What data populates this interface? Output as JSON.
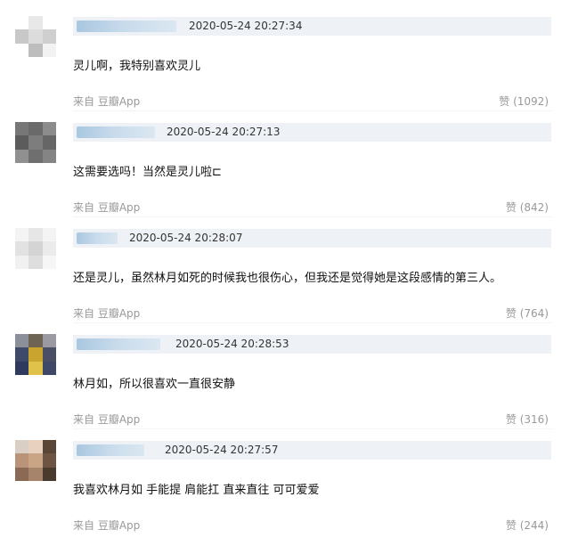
{
  "comments": [
    {
      "timestamp": "2020-05-24 20:27:34",
      "text": "灵儿啊，我特别喜欢灵儿",
      "source": "来自 豆瓣App",
      "likes": "赞 (1092)"
    },
    {
      "timestamp": "2020-05-24 20:27:13",
      "text": "这需要选吗！当然是灵儿啦⊏",
      "source": "来自 豆瓣App",
      "likes": "赞 (842)"
    },
    {
      "timestamp": "2020-05-24 20:28:07",
      "text": "还是灵儿，虽然林月如死的时候我也很伤心，但我还是觉得她是这段感情的第三人。",
      "source": "来自 豆瓣App",
      "likes": "赞 (764)"
    },
    {
      "timestamp": "2020-05-24 20:28:53",
      "text": "林月如，所以很喜欢一直很安静",
      "source": "来自 豆瓣App",
      "likes": "赞 (316)"
    },
    {
      "timestamp": "2020-05-24 20:27:57",
      "text": "我喜欢林月如 手能提 肩能扛 直来直往 可可爱爱",
      "source": "来自 豆瓣App",
      "likes": "赞 (244)"
    }
  ]
}
